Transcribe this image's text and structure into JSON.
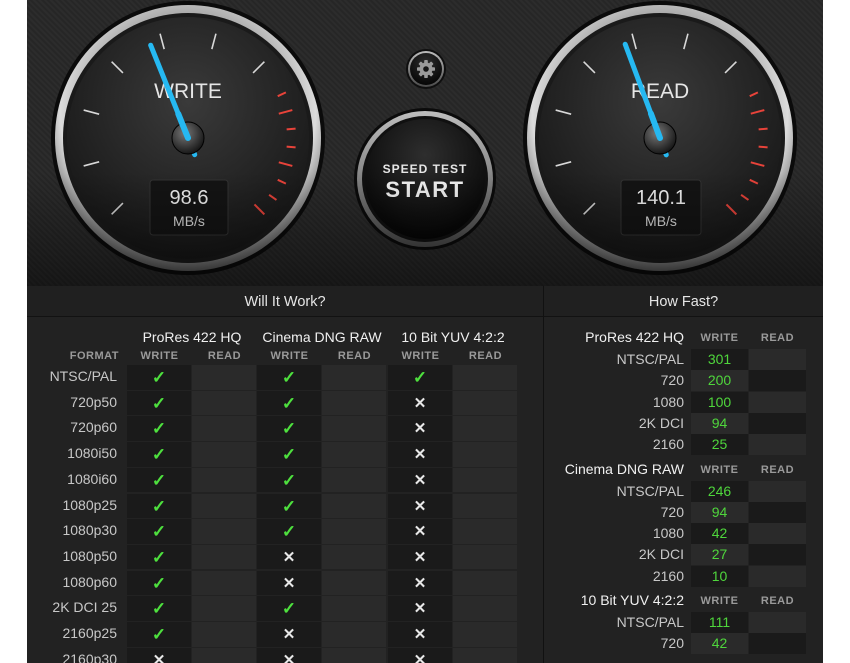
{
  "settings": {
    "icon": "gear-icon"
  },
  "start_button": {
    "line1": "SPEED TEST",
    "line2": "START"
  },
  "write_gauge": {
    "label": "WRITE",
    "value": "98.6",
    "unit": "MB/s",
    "value_number": 98.6
  },
  "read_gauge": {
    "label": "READ",
    "value": "140.1",
    "unit": "MB/s",
    "value_number": 140.1
  },
  "colors": {
    "needle": "#26b9f2",
    "redline": "#e8433a",
    "ok": "#4ee03e",
    "accent_green": "#4fd63c"
  },
  "will_it_work": {
    "title": "Will It Work?",
    "format_header": "FORMAT",
    "write_label": "WRITE",
    "read_label": "READ",
    "codecs": [
      "ProRes 422 HQ",
      "Cinema DNG RAW",
      "10 Bit YUV 4:2:2"
    ],
    "check_icon": "✓",
    "cross_icon": "✕",
    "rows": [
      {
        "format": "NTSC/PAL",
        "results": [
          "yes",
          "yes",
          "yes"
        ]
      },
      {
        "format": "720p50",
        "results": [
          "yes",
          "yes",
          "no"
        ]
      },
      {
        "format": "720p60",
        "results": [
          "yes",
          "yes",
          "no"
        ]
      },
      {
        "format": "1080i50",
        "results": [
          "yes",
          "yes",
          "no"
        ]
      },
      {
        "format": "1080i60",
        "results": [
          "yes",
          "yes",
          "no"
        ]
      },
      {
        "format": "1080p25",
        "results": [
          "yes",
          "yes",
          "no"
        ]
      },
      {
        "format": "1080p30",
        "results": [
          "yes",
          "yes",
          "no"
        ]
      },
      {
        "format": "1080p50",
        "results": [
          "yes",
          "no",
          "no"
        ]
      },
      {
        "format": "1080p60",
        "results": [
          "yes",
          "no",
          "no"
        ]
      },
      {
        "format": "2K DCI 25",
        "results": [
          "yes",
          "yes",
          "no"
        ]
      },
      {
        "format": "2160p25",
        "results": [
          "yes",
          "no",
          "no"
        ]
      },
      {
        "format": "2160p30",
        "results": [
          "no",
          "no",
          "no"
        ]
      }
    ]
  },
  "how_fast": {
    "title": "How Fast?",
    "write_label": "WRITE",
    "read_label": "READ",
    "groups": [
      {
        "name": "ProRes 422 HQ",
        "rows": [
          {
            "res": "NTSC/PAL",
            "write": "301"
          },
          {
            "res": "720",
            "write": "200"
          },
          {
            "res": "1080",
            "write": "100"
          },
          {
            "res": "2K DCI",
            "write": "94"
          },
          {
            "res": "2160",
            "write": "25"
          }
        ]
      },
      {
        "name": "Cinema DNG RAW",
        "rows": [
          {
            "res": "NTSC/PAL",
            "write": "246"
          },
          {
            "res": "720",
            "write": "94"
          },
          {
            "res": "1080",
            "write": "42"
          },
          {
            "res": "2K DCI",
            "write": "27"
          },
          {
            "res": "2160",
            "write": "10"
          }
        ]
      },
      {
        "name": "10 Bit YUV 4:2:2",
        "rows": [
          {
            "res": "NTSC/PAL",
            "write": "111"
          },
          {
            "res": "720",
            "write": "42"
          }
        ]
      }
    ]
  }
}
